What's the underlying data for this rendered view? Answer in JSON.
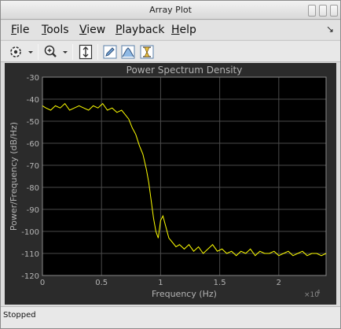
{
  "window": {
    "title": "Array Plot"
  },
  "menubar": {
    "items": [
      {
        "mnemonic": "F",
        "rest": "ile"
      },
      {
        "mnemonic": "T",
        "rest": "ools"
      },
      {
        "mnemonic": "V",
        "rest": "iew"
      },
      {
        "mnemonic": "P",
        "rest": "layback"
      },
      {
        "mnemonic": "H",
        "rest": "elp"
      }
    ],
    "dock_glyph": "↘"
  },
  "toolbar": {
    "icons": [
      "gear-icon",
      "zoom-in-icon",
      "autoscale-icon",
      "edit-icon",
      "peak-finder-icon",
      "cursor-measurement-icon"
    ]
  },
  "status": {
    "text": "Stopped"
  },
  "colors": {
    "plot_background": "#000000",
    "figure_background": "#2b2b2b",
    "trace": "#ffff00",
    "axis_text": "#b4b4b4"
  },
  "chart_data": {
    "type": "line",
    "title": "Power Spectrum Density",
    "xlabel": "Frequency (Hz)",
    "ylabel": "Power/Frequency (dB/Hz)",
    "x_exponent_label": "×10",
    "x_exponent": "4",
    "xlim": [
      0,
      24000
    ],
    "ylim": [
      -120,
      -30
    ],
    "xticks": [
      0,
      5000,
      10000,
      15000,
      20000
    ],
    "xtick_labels": [
      "0",
      "0.5",
      "1",
      "1.5",
      "2"
    ],
    "yticks": [
      -30,
      -40,
      -50,
      -60,
      -70,
      -80,
      -90,
      -100,
      -110,
      -120
    ],
    "ytick_labels": [
      "-30",
      "-40",
      "-50",
      "-60",
      "-70",
      "-80",
      "-90",
      "-100",
      "-110",
      "-120"
    ],
    "grid": true,
    "series": [
      {
        "x": [
          0,
          300,
          700,
          1100,
          1500,
          1900,
          2300,
          2700,
          3100,
          3500,
          3900,
          4300,
          4700,
          5100,
          5500,
          5900,
          6300,
          6700,
          7000,
          7300,
          7600,
          7900,
          8200,
          8500,
          8800,
          9000,
          9200,
          9400,
          9600,
          9800,
          10000,
          10200,
          10400,
          10700,
          11000,
          11300,
          11600,
          12000,
          12400,
          12800,
          13200,
          13600,
          14000,
          14400,
          14800,
          15200,
          15600,
          16000,
          16400,
          16800,
          17200,
          17600,
          18000,
          18400,
          18800,
          19200,
          19600,
          20000,
          20400,
          20800,
          21200,
          21600,
          22000,
          22400,
          22800,
          23200,
          23600,
          24000
        ],
        "y": [
          -43,
          -44,
          -45,
          -43,
          -44,
          -42,
          -45,
          -44,
          -43,
          -44,
          -45,
          -43,
          -44,
          -42,
          -45,
          -44,
          -46,
          -45,
          -47,
          -49,
          -53,
          -56,
          -61,
          -65,
          -72,
          -78,
          -86,
          -94,
          -100,
          -103,
          -95,
          -93,
          -97,
          -103,
          -105,
          -107,
          -106,
          -108,
          -106,
          -109,
          -107,
          -110,
          -108,
          -106,
          -109,
          -108,
          -110,
          -109,
          -111,
          -109,
          -110,
          -108,
          -111,
          -109,
          -110,
          -110,
          -109,
          -111,
          -110,
          -109,
          -111,
          -110,
          -109,
          -111,
          -110,
          -110,
          -111,
          -110
        ]
      }
    ]
  }
}
